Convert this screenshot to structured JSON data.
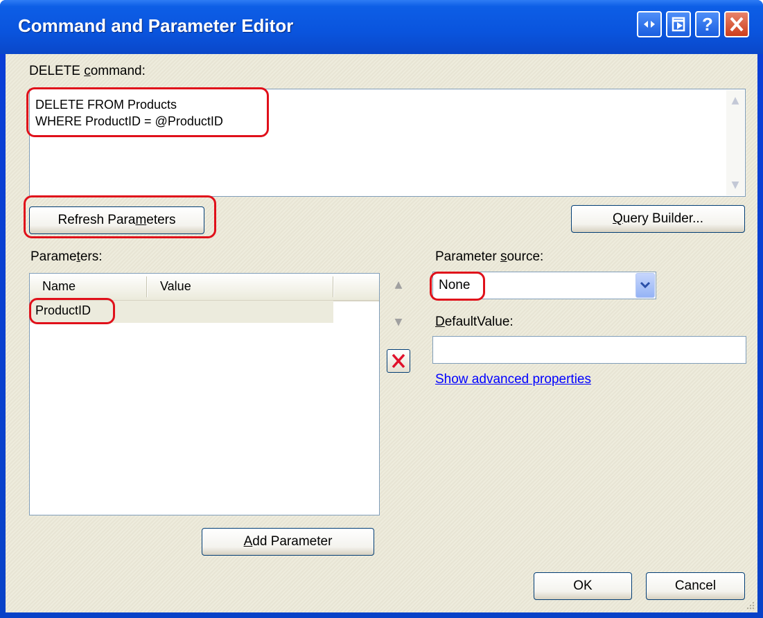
{
  "window": {
    "title": "Command and Parameter Editor",
    "controls": {
      "restore_icon": "swap-arrows-icon",
      "maximize_icon": "window-icon",
      "help_label": "?",
      "close_label": "X"
    }
  },
  "command": {
    "label_prefix": "DELETE ",
    "label_accel": "c",
    "label_suffix": "ommand:",
    "lines": [
      "DELETE FROM Products",
      "WHERE ProductID = @ProductID"
    ]
  },
  "buttons": {
    "refresh_pre": "Refresh Para",
    "refresh_accel": "m",
    "refresh_post": "eters",
    "query_accel": "Q",
    "query_post": "uery Builder...",
    "add_accel": "A",
    "add_post": "dd Parameter",
    "ok": "OK",
    "cancel": "Cancel"
  },
  "parameters": {
    "label_pre": "Parame",
    "label_accel": "t",
    "label_post": "ers:",
    "columns": [
      "Name",
      "Value"
    ],
    "rows": [
      {
        "name": "ProductID",
        "value": ""
      }
    ]
  },
  "source": {
    "label_pre": "Parameter ",
    "label_accel": "s",
    "label_post": "ource:",
    "selected": "None"
  },
  "default_value": {
    "label_accel": "D",
    "label_post": "efaultValue:",
    "value": ""
  },
  "advanced_link": "Show advanced properties",
  "colors": {
    "highlight": "#e0101a",
    "titlebar": "#0a54dd",
    "dialog_bg": "#ece9d8"
  }
}
